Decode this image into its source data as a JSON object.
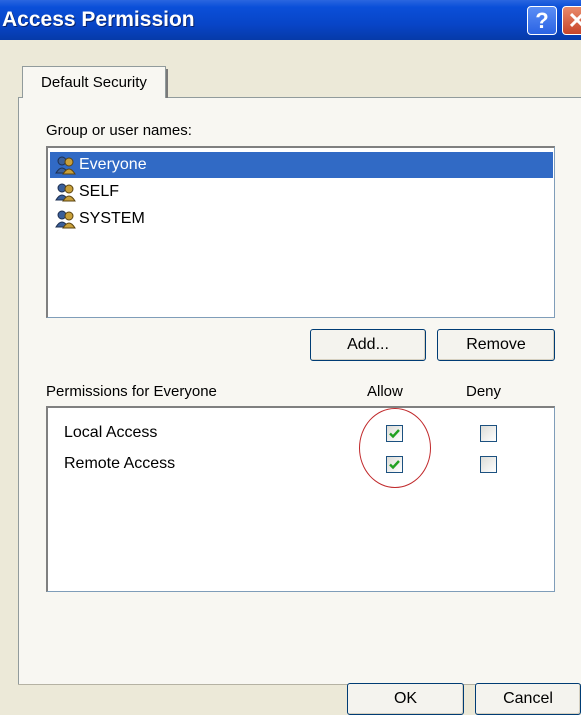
{
  "window": {
    "title": "Access Permission",
    "help_icon": "help-icon",
    "close_icon": "close-icon",
    "help_glyph": "?",
    "close_glyph": "✕"
  },
  "tabs": [
    {
      "label": "Default Security",
      "active": true
    }
  ],
  "groups": {
    "label": "Group or user names:",
    "items": [
      {
        "name": "Everyone",
        "icon": "user-group-icon",
        "selected": true
      },
      {
        "name": "SELF",
        "icon": "user-group-icon",
        "selected": false
      },
      {
        "name": "SYSTEM",
        "icon": "user-group-icon",
        "selected": false
      }
    ],
    "add_label": "Add...",
    "remove_label": "Remove"
  },
  "permissions": {
    "label": "Permissions for Everyone",
    "allow_header": "Allow",
    "deny_header": "Deny",
    "rows": [
      {
        "name": "Local Access",
        "allow": true,
        "deny": false
      },
      {
        "name": "Remote Access",
        "allow": true,
        "deny": false
      }
    ]
  },
  "footer": {
    "ok_label": "OK",
    "cancel_label": "Cancel"
  },
  "colors": {
    "title_bar": "#0845c8",
    "selection": "#316ac5",
    "annotation_circle": "#c0282a",
    "check": "#21a121"
  }
}
